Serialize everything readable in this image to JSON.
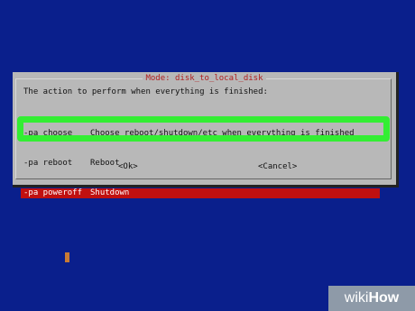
{
  "dialog": {
    "title": "Mode: disk_to_local_disk",
    "prompt": "The action to perform when everything is finished:",
    "items": [
      {
        "tag": "-pa choose",
        "description": "Choose reboot/shutdown/etc when everything is finished",
        "selected": false
      },
      {
        "tag": "-pa reboot",
        "description": "Reboot",
        "selected": false
      },
      {
        "tag": "-pa poweroff",
        "description": "Shutdown",
        "selected": true
      }
    ],
    "ok_label": "<Ok>",
    "cancel_label": "<Cancel>"
  },
  "watermark": {
    "wiki": "wiki",
    "how": "How"
  },
  "colors": {
    "background": "#0a1f8c",
    "dialog": "#b8b8b8",
    "selection": "#c01010",
    "highlight_border": "#33ee33",
    "title_text": "#b02020",
    "cursor": "#c87a35"
  }
}
